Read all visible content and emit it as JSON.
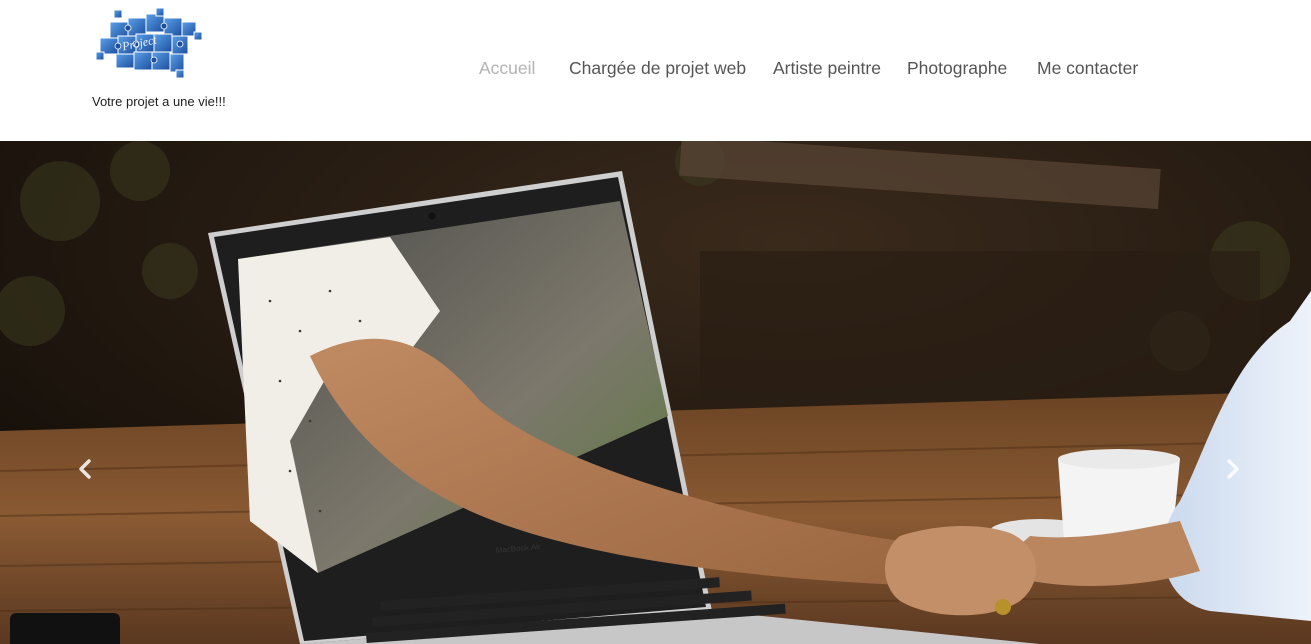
{
  "header": {
    "logo_icon": "puzzle-project-logo",
    "logo_text": "Project",
    "tagline": "Votre projet a une vie!!!"
  },
  "nav": {
    "items": [
      {
        "label": "Accueil",
        "active": true
      },
      {
        "label": "Chargée de projet web",
        "active": false
      },
      {
        "label": "Artiste peintre",
        "active": false
      },
      {
        "label": "Photographe",
        "active": false
      },
      {
        "label": "Me contacter",
        "active": false
      }
    ]
  },
  "hero": {
    "image": "handshake-through-laptop-photo",
    "laptop_brand": "MacBook Air",
    "prev_icon": "chevron-left-icon",
    "next_icon": "chevron-right-icon"
  },
  "colors": {
    "nav_text": "#555555",
    "nav_active": "#b3b3b3",
    "logo_blue": "#2f6fc4"
  }
}
